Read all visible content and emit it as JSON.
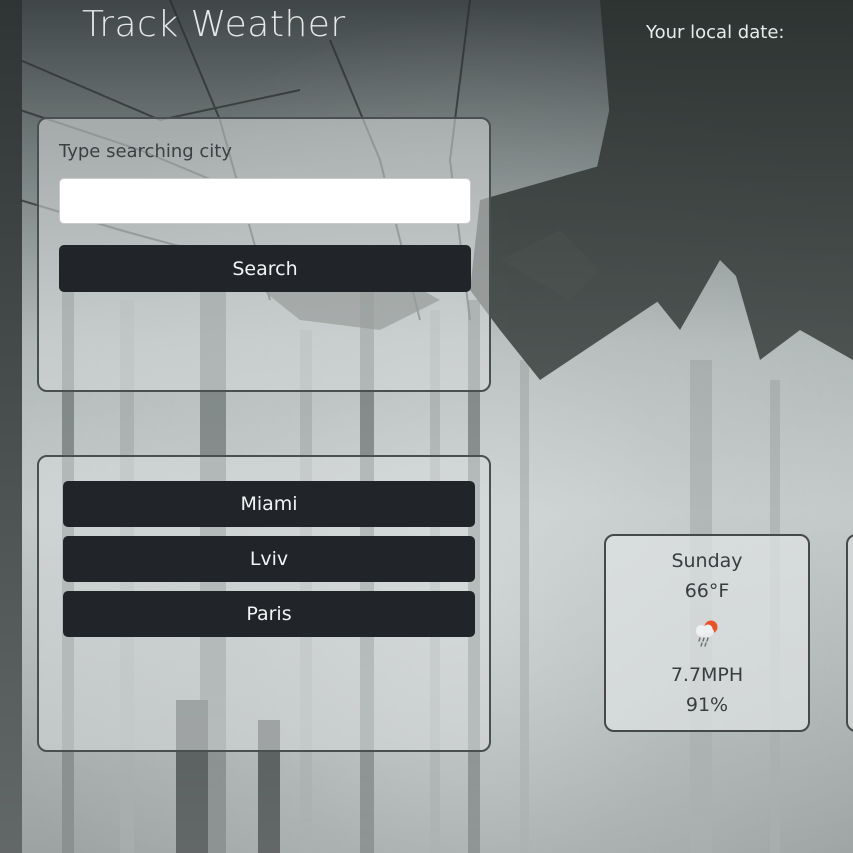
{
  "header": {
    "title": "Track Weather",
    "local_date_label": "Your local date:"
  },
  "search": {
    "label": "Type searching city",
    "input_value": "",
    "button_label": "Search"
  },
  "history": {
    "cities": [
      "Miami",
      "Lviv",
      "Paris"
    ]
  },
  "forecast": [
    {
      "day": "Sunday",
      "temp": "66°F",
      "icon": "rain-cloud-sun-icon",
      "wind": "7.7MPH",
      "humidity": "91%"
    }
  ]
}
